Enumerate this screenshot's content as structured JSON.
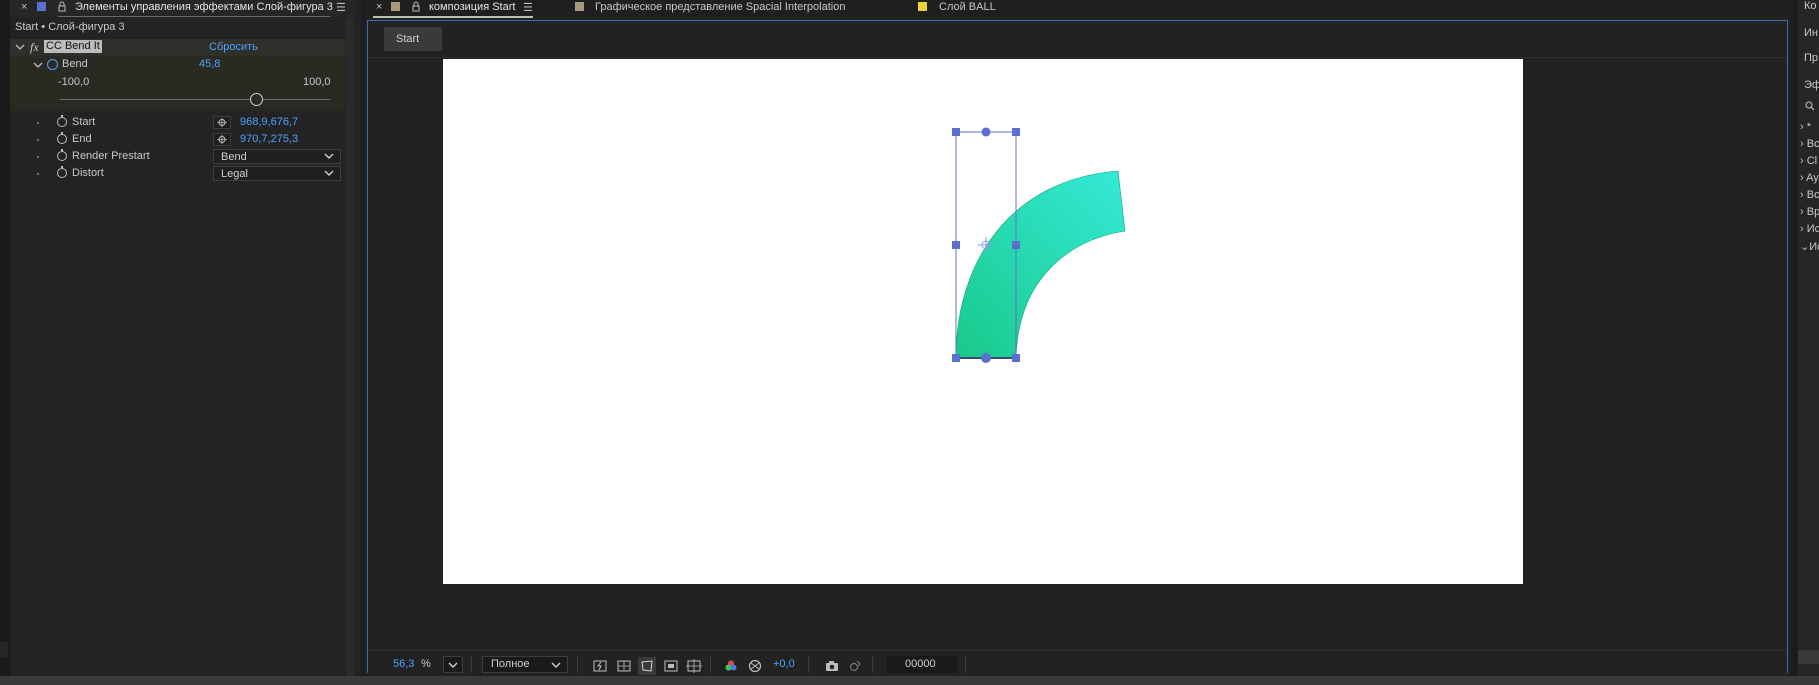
{
  "effects_panel": {
    "tab_title": "Элементы управления эффектами Слой-фигура 3",
    "breadcrumb": "Start • Слой-фигура 3",
    "fx_symbol": "fx",
    "effect_name": "CC Bend It",
    "reset_label": "Сбросить",
    "bend": {
      "label": "Bend",
      "value": "45,8",
      "min_label": "-100,0",
      "max_label": "100,0",
      "slider_fraction": 0.729
    },
    "props": [
      {
        "label": "Start",
        "value": "968,9,676,7"
      },
      {
        "label": "End",
        "value": "970,7,275,3"
      },
      {
        "label": "Render Prestart",
        "value": "Bend"
      },
      {
        "label": "Distort",
        "value": "Legal"
      }
    ]
  },
  "viewer": {
    "tabs": [
      {
        "label": "композиция Start"
      },
      {
        "label": "Графическое представление Spacial Interpolation"
      },
      {
        "label": "Слой BALL"
      }
    ],
    "flow_button": "Start",
    "zoom_value": "56,3",
    "zoom_unit": "%",
    "resolution": "Полное",
    "exposure": "+0,0",
    "timecode": "00000"
  },
  "right_panel": {
    "labels": [
      "Ко",
      "Ин",
      "Пр",
      "Эф"
    ],
    "tree": [
      "* ",
      "Bc",
      "Cl",
      "Ay",
      "Bc",
      "Bp",
      "Иc",
      "Иc"
    ]
  },
  "colors": {
    "accent_blue": "#4fa0ff",
    "panel_bg": "#232323",
    "selection_handle": "#5b6fcf",
    "shape_gradient_start": "#19c98a",
    "shape_gradient_end": "#35ead8",
    "tab_ball_color": "#e8d33a",
    "tab_composition_color": "#a79a7a"
  }
}
